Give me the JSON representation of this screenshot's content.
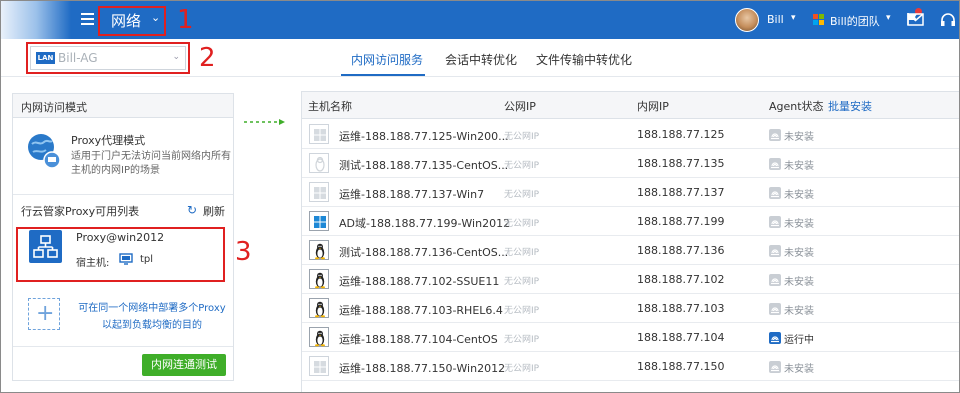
{
  "header": {
    "network_title": "网络",
    "user_name": "Bill",
    "team_name": "Bill的团队"
  },
  "annotations": [
    "1",
    "2",
    "3"
  ],
  "lan_selector": {
    "badge": "LAN",
    "value": "Bill-AG"
  },
  "tabs": [
    {
      "label": "内网访问服务",
      "active": true
    },
    {
      "label": "会话中转优化",
      "active": false
    },
    {
      "label": "文件传输中转优化",
      "active": false
    }
  ],
  "left_panel": {
    "header": "内网访问模式",
    "mode_title": "Proxy代理模式",
    "mode_desc": "适用于门户无法访问当前网络内所有主机的内网IP的场景",
    "list_title": "行云管家Proxy可用列表",
    "refresh_label": "刷新",
    "proxy_name": "Proxy@win2012",
    "host_label": "宿主机:",
    "host_name": "tpl",
    "add_hint": "可在同一个网络中部署多个Proxy以起到负载均衡的目的",
    "test_button": "内网连通测试"
  },
  "table": {
    "columns": {
      "name": "主机名称",
      "public_ip": "公网IP",
      "private_ip": "内网IP",
      "agent": "Agent状态",
      "batch_install": "批量安装"
    },
    "rows": [
      {
        "name": "运维-188.188.77.125-Win200...",
        "public_ip": "无公网IP",
        "private_ip": "188.188.77.125",
        "agent": "未安装",
        "os": "windows",
        "os_active": false,
        "agent_running": false
      },
      {
        "name": "测试-188.188.77.135-CentOS...",
        "public_ip": "无公网IP",
        "private_ip": "188.188.77.135",
        "agent": "未安装",
        "os": "linux",
        "os_active": false,
        "agent_running": false
      },
      {
        "name": "运维-188.188.77.137-Win7",
        "public_ip": "无公网IP",
        "private_ip": "188.188.77.137",
        "agent": "未安装",
        "os": "windows",
        "os_active": false,
        "agent_running": false
      },
      {
        "name": "AD域-188.188.77.199-Win2012",
        "public_ip": "无公网IP",
        "private_ip": "188.188.77.199",
        "agent": "未安装",
        "os": "windows",
        "os_active": true,
        "agent_running": false
      },
      {
        "name": "测试-188.188.77.136-CentOS...",
        "public_ip": "无公网IP",
        "private_ip": "188.188.77.136",
        "agent": "未安装",
        "os": "linux",
        "os_active": true,
        "agent_running": false
      },
      {
        "name": "运维-188.188.77.102-SSUE11",
        "public_ip": "无公网IP",
        "private_ip": "188.188.77.102",
        "agent": "未安装",
        "os": "linux",
        "os_active": true,
        "agent_running": false
      },
      {
        "name": "运维-188.188.77.103-RHEL6.4",
        "public_ip": "无公网IP",
        "private_ip": "188.188.77.103",
        "agent": "未安装",
        "os": "linux",
        "os_active": true,
        "agent_running": false
      },
      {
        "name": "运维-188.188.77.104-CentOS",
        "public_ip": "无公网IP",
        "private_ip": "188.188.77.104",
        "agent": "运行中",
        "os": "linux",
        "os_active": true,
        "agent_running": true
      },
      {
        "name": "运维-188.188.77.150-Win2012",
        "public_ip": "无公网IP",
        "private_ip": "188.188.77.150",
        "agent": "未安装",
        "os": "windows",
        "os_active": false,
        "agent_running": false
      }
    ]
  },
  "colors": {
    "brand_blue": "#1f6bc4",
    "annotation_red": "#e02020",
    "button_green": "#3fae29",
    "muted_gray": "#b5bbc2"
  }
}
